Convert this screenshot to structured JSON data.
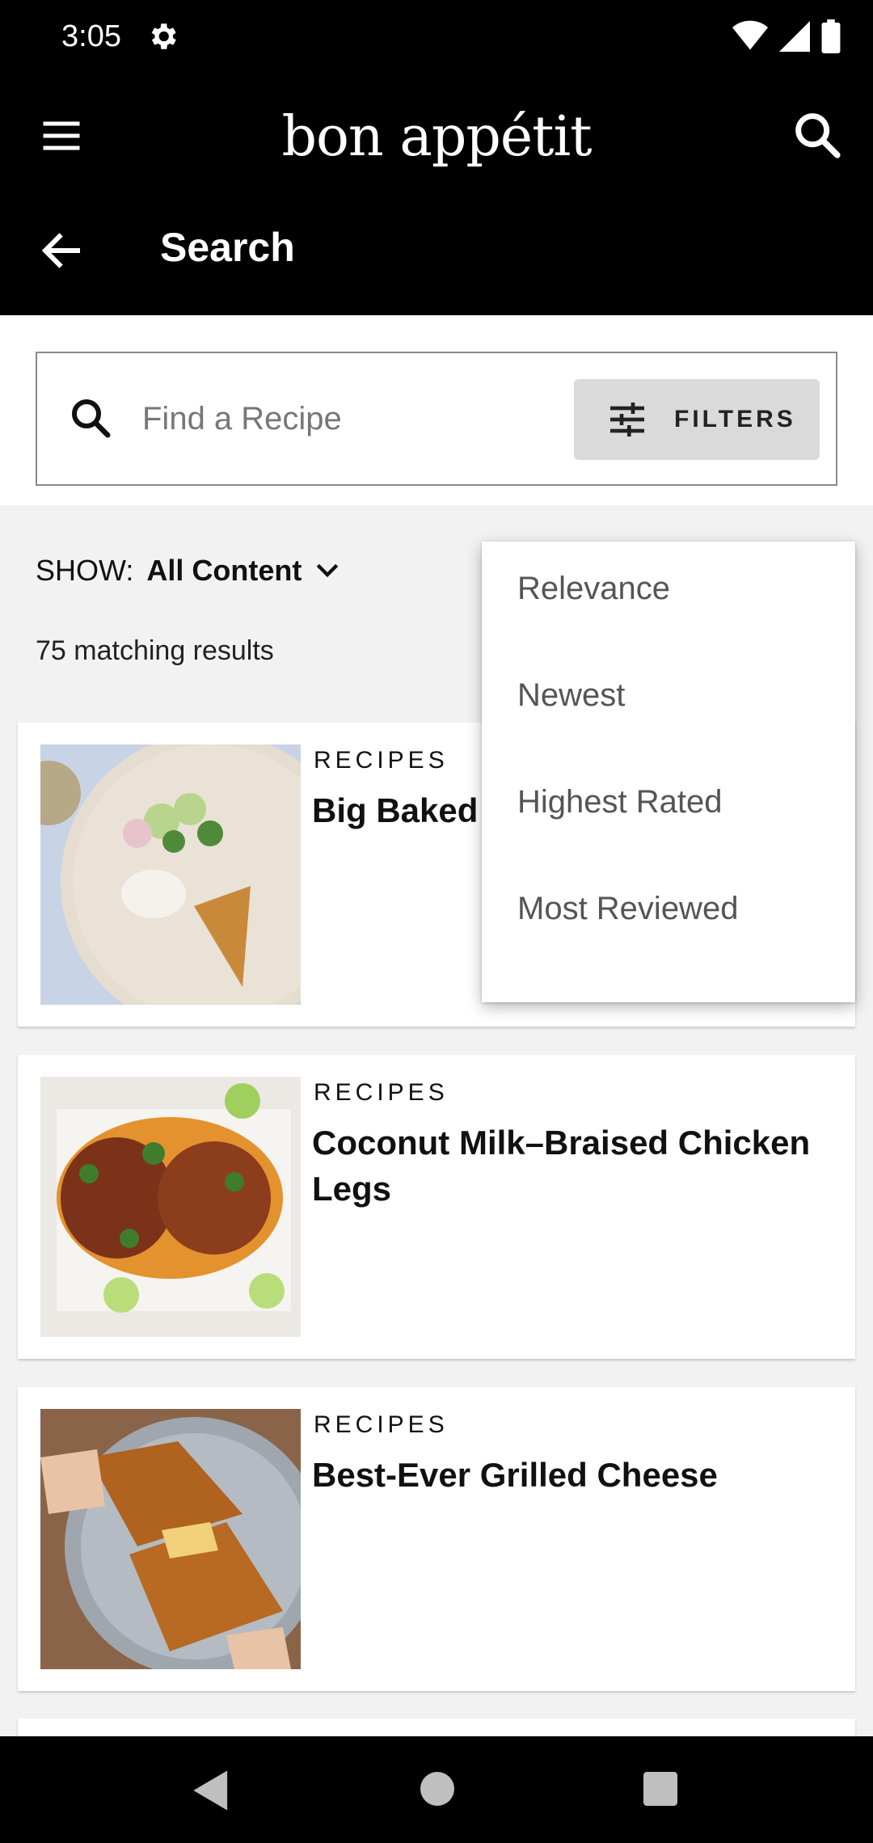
{
  "status_bar": {
    "time": "3:05"
  },
  "app_bar": {
    "logo": "bon appétit",
    "title": "Search"
  },
  "search": {
    "placeholder": "Find a Recipe",
    "filters_label": "FILTERS"
  },
  "show": {
    "label": "SHOW:",
    "value": "All Content"
  },
  "results": {
    "count_text": "75 matching results"
  },
  "cards": [
    {
      "category": "RECIPES",
      "title": "Big Baked Cucumber"
    },
    {
      "category": "RECIPES",
      "title": "Coconut Milk–Braised Chicken Legs"
    },
    {
      "category": "RECIPES",
      "title": "Best-Ever Grilled Cheese"
    }
  ],
  "sort_menu": {
    "items": [
      "Relevance",
      "Newest",
      "Highest Rated",
      "Most Reviewed"
    ]
  },
  "colors": {
    "app_bar": "#000000",
    "background": "#f2f2f2",
    "filters_button": "#dadada"
  }
}
